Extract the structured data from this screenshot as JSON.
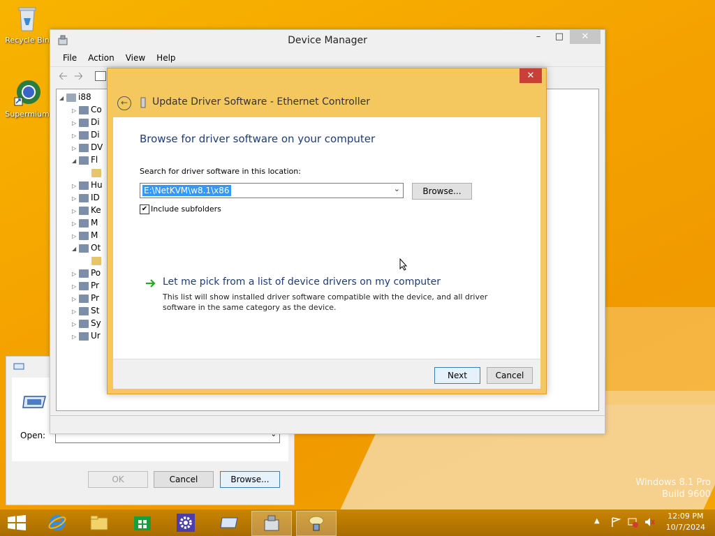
{
  "desktop": {
    "icons": [
      {
        "label": "Recycle Bin"
      },
      {
        "label": "Supermium"
      }
    ],
    "watermark": {
      "line1": "Windows 8.1 Pro",
      "line2": "Build 9600"
    }
  },
  "device_manager": {
    "title": "Device Manager",
    "menu": [
      "File",
      "Action",
      "View",
      "Help"
    ],
    "tree_root": "i88",
    "tree_items": [
      "Co",
      "Di",
      "Di",
      "DV",
      "Fl",
      "",
      "Hu",
      "ID",
      "Ke",
      "M",
      "M",
      "Ot",
      "",
      "Po",
      "Pr",
      "Pr",
      "St",
      "Sy",
      "Ur"
    ]
  },
  "run_dialog": {
    "open_label": "Open:",
    "ok_label": "OK",
    "cancel_label": "Cancel",
    "browse_label": "Browse..."
  },
  "wizard": {
    "title": "Update Driver Software - Ethernet Controller",
    "heading": "Browse for driver software on your computer",
    "search_label": "Search for driver software in this location:",
    "path_value": "E:\\NetKVM\\w8.1\\x86",
    "browse_label": "Browse...",
    "include_subfolders_label": "Include subfolders",
    "include_subfolders_checked": true,
    "pick_link": "Let me pick from a list of device drivers on my computer",
    "pick_desc_line1": "This list will show installed driver software compatible with the device, and all driver",
    "pick_desc_line2": "software in the same category as the device.",
    "next_label": "Next",
    "cancel_label": "Cancel"
  },
  "taskbar": {
    "apps": [
      "start",
      "internet-explorer",
      "file-explorer",
      "store",
      "settings",
      "run",
      "device-manager",
      "network"
    ],
    "clock_time": "12:09 PM",
    "clock_date": "10/7/2024"
  },
  "colors": {
    "desktop_bg": "#f5a800",
    "wizard_frame": "#f4c85e",
    "heading_blue": "#1e3c78",
    "link_arrow": "#2aa52a",
    "close_red": "#c84036"
  }
}
